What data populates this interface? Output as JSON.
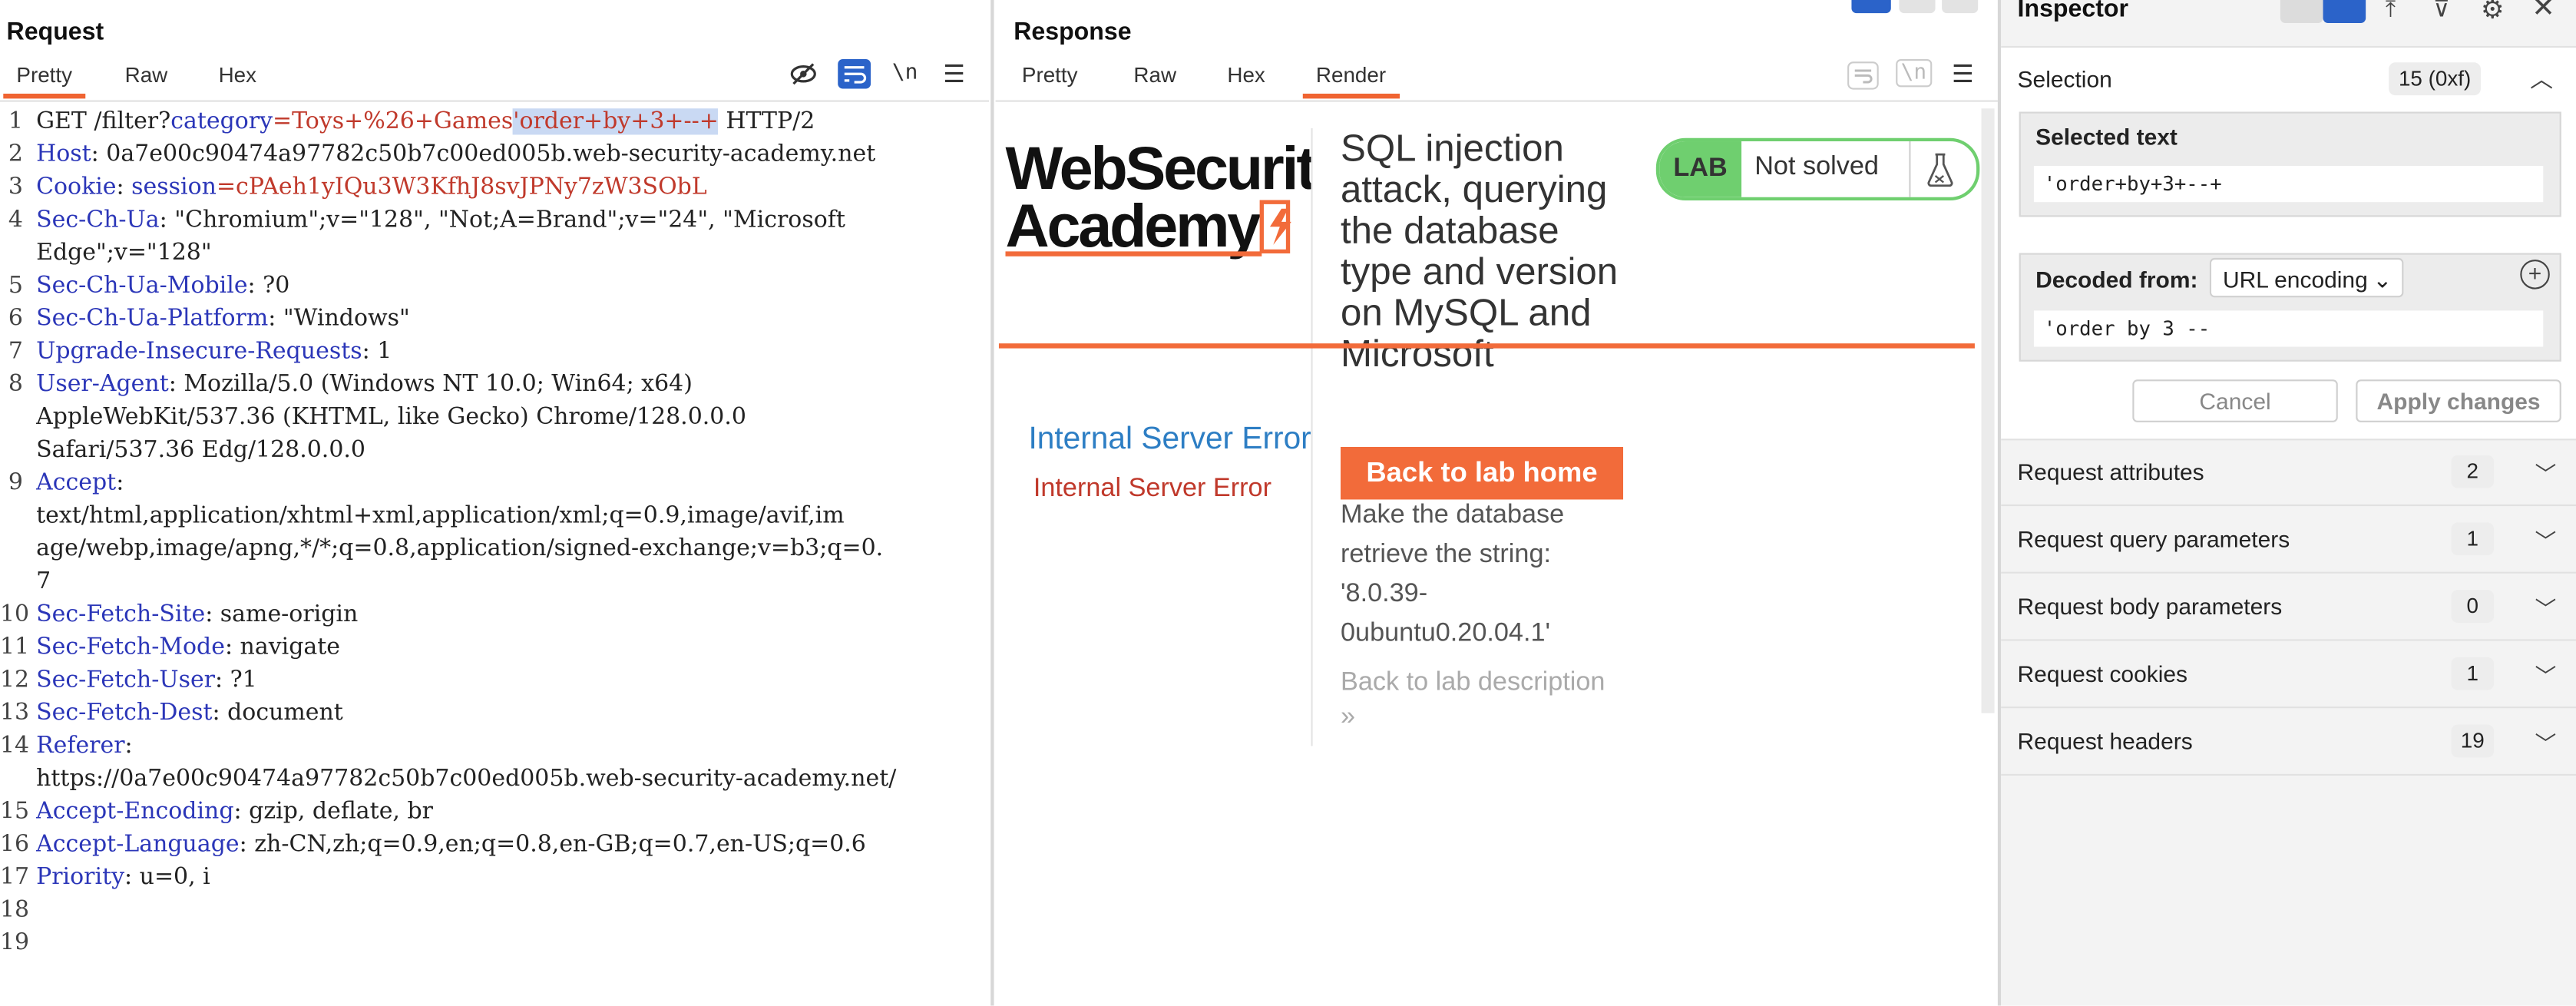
{
  "request": {
    "title": "Request",
    "tabs": [
      "Pretty",
      "Raw",
      "Hex"
    ],
    "icons": [
      "eye-off-icon",
      "wrap-icon",
      "newline-icon",
      "menu-icon"
    ],
    "newline_label": "\\n",
    "lines": [
      {
        "n": "1",
        "parts": [
          {
            "t": "GET /filter?",
            "c": ""
          },
          {
            "t": "category",
            "c": "hk"
          },
          {
            "t": "=Toys+%26+Games",
            "c": "qk"
          },
          {
            "t": "'order+by+3+--+",
            "c": "qk sel"
          },
          {
            "t": " HTTP/2",
            "c": ""
          }
        ]
      },
      {
        "n": "2",
        "parts": [
          {
            "t": "Host",
            "c": "hk"
          },
          {
            "t": ": 0a7e00c90474a97782c50b7c00ed005b.web-security-academy.net",
            "c": ""
          }
        ]
      },
      {
        "n": "3",
        "parts": [
          {
            "t": "Cookie",
            "c": "hk"
          },
          {
            "t": ": ",
            "c": ""
          },
          {
            "t": "session",
            "c": "hk"
          },
          {
            "t": "=cPAeh1yIQu3W3KfhJ8svJPNy7zW3SObL",
            "c": "qk"
          }
        ]
      },
      {
        "n": "4",
        "parts": [
          {
            "t": "Sec-Ch-Ua",
            "c": "hk"
          },
          {
            "t": ": \"Chromium\";v=\"128\", \"Not;A=Brand\";v=\"24\", \"Microsoft",
            "c": ""
          }
        ]
      },
      {
        "n": "",
        "parts": [
          {
            "t": "Edge\";v=\"128\"",
            "c": ""
          }
        ]
      },
      {
        "n": "5",
        "parts": [
          {
            "t": "Sec-Ch-Ua-Mobile",
            "c": "hk"
          },
          {
            "t": ": ?0",
            "c": ""
          }
        ]
      },
      {
        "n": "6",
        "parts": [
          {
            "t": "Sec-Ch-Ua-Platform",
            "c": "hk"
          },
          {
            "t": ": \"Windows\"",
            "c": ""
          }
        ]
      },
      {
        "n": "7",
        "parts": [
          {
            "t": "Upgrade-Insecure-Requests",
            "c": "hk"
          },
          {
            "t": ": 1",
            "c": ""
          }
        ]
      },
      {
        "n": "8",
        "parts": [
          {
            "t": "User-Agent",
            "c": "hk"
          },
          {
            "t": ": Mozilla/5.0 (Windows NT 10.0; Win64; x64)",
            "c": ""
          }
        ]
      },
      {
        "n": "",
        "parts": [
          {
            "t": "AppleWebKit/537.36 (KHTML, like Gecko) Chrome/128.0.0.0",
            "c": ""
          }
        ]
      },
      {
        "n": "",
        "parts": [
          {
            "t": "Safari/537.36 Edg/128.0.0.0",
            "c": ""
          }
        ]
      },
      {
        "n": "9",
        "parts": [
          {
            "t": "Accept",
            "c": "hk"
          },
          {
            "t": ":",
            "c": ""
          }
        ]
      },
      {
        "n": "",
        "parts": [
          {
            "t": "text/html,application/xhtml+xml,application/xml;q=0.9,image/avif,im",
            "c": ""
          }
        ]
      },
      {
        "n": "",
        "parts": [
          {
            "t": "age/webp,image/apng,*/*;q=0.8,application/signed-exchange;v=b3;q=0.",
            "c": ""
          }
        ]
      },
      {
        "n": "",
        "parts": [
          {
            "t": "7",
            "c": ""
          }
        ]
      },
      {
        "n": "10",
        "parts": [
          {
            "t": "Sec-Fetch-Site",
            "c": "hk"
          },
          {
            "t": ": same-origin",
            "c": ""
          }
        ]
      },
      {
        "n": "11",
        "parts": [
          {
            "t": "Sec-Fetch-Mode",
            "c": "hk"
          },
          {
            "t": ": navigate",
            "c": ""
          }
        ]
      },
      {
        "n": "12",
        "parts": [
          {
            "t": "Sec-Fetch-User",
            "c": "hk"
          },
          {
            "t": ": ?1",
            "c": ""
          }
        ]
      },
      {
        "n": "13",
        "parts": [
          {
            "t": "Sec-Fetch-Dest",
            "c": "hk"
          },
          {
            "t": ": document",
            "c": ""
          }
        ]
      },
      {
        "n": "14",
        "parts": [
          {
            "t": "Referer",
            "c": "hk"
          },
          {
            "t": ":",
            "c": ""
          }
        ]
      },
      {
        "n": "",
        "parts": [
          {
            "t": "https://0a7e00c90474a97782c50b7c00ed005b.web-security-academy.net/",
            "c": ""
          }
        ]
      },
      {
        "n": "15",
        "parts": [
          {
            "t": "Accept-Encoding",
            "c": "hk"
          },
          {
            "t": ": gzip, deflate, br",
            "c": ""
          }
        ]
      },
      {
        "n": "16",
        "parts": [
          {
            "t": "Accept-Language",
            "c": "hk"
          },
          {
            "t": ": zh-CN,zh;q=0.9,en;q=0.8,en-GB;q=0.7,en-US;q=0.6",
            "c": ""
          }
        ]
      },
      {
        "n": "17",
        "parts": [
          {
            "t": "Priority",
            "c": "hk"
          },
          {
            "t": ": u=0, i",
            "c": ""
          }
        ]
      },
      {
        "n": "18",
        "parts": []
      },
      {
        "n": "19",
        "parts": []
      }
    ]
  },
  "response": {
    "title": "Response",
    "tabs": [
      "Pretty",
      "Raw",
      "Hex",
      "Render"
    ],
    "active_tab": "Render",
    "newline_label": "\\n",
    "render": {
      "logo_line1": "WebSecurit",
      "logo_line2": "Academy",
      "lab_title": "SQL injection attack, querying the database type and version on MySQL and Microsoft",
      "lab_badge": "LAB",
      "lab_status": "Not solved",
      "back_button": "Back to lab home",
      "goal_text": "Make the database retrieve the string: '8.0.39-0ubuntu0.20.04.1'",
      "back_description": "Back to lab description",
      "error_heading": "Internal Server Error",
      "error_text": "Internal Server Error"
    }
  },
  "inspector": {
    "title": "Inspector",
    "selection_label": "Selection",
    "selection_count": "15 (0xf)",
    "selected_text_label": "Selected text",
    "selected_text_value": "'order+by+3+--+",
    "decoded_from_label": "Decoded from:",
    "decoded_from_value": "URL encoding",
    "decoded_value": "'order by 3 --",
    "cancel_label": "Cancel",
    "apply_label": "Apply changes",
    "sections": [
      {
        "label": "Request attributes",
        "count": "2"
      },
      {
        "label": "Request query parameters",
        "count": "1"
      },
      {
        "label": "Request body parameters",
        "count": "0"
      },
      {
        "label": "Request cookies",
        "count": "1"
      },
      {
        "label": "Request headers",
        "count": "19"
      }
    ]
  },
  "colors": {
    "accent": "#f06432",
    "header_key": "#2b36b8",
    "query_value": "#c0392b",
    "selection": "#c9d9f3",
    "lab_green": "#6fcf6f",
    "error_blue": "#2d7ec4",
    "error_red": "#c0392b"
  }
}
